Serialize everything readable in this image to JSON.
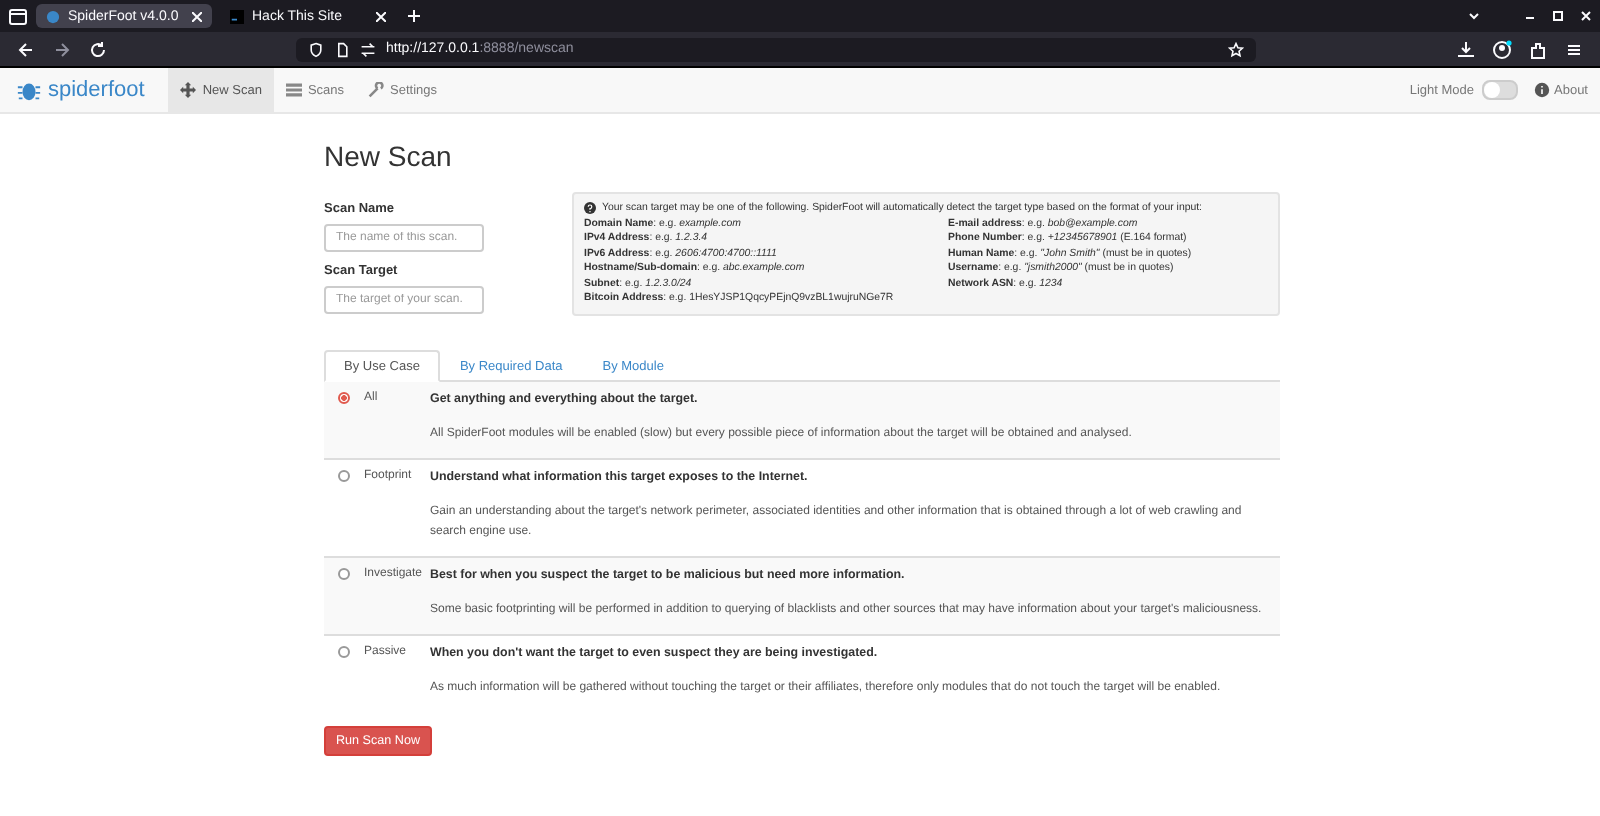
{
  "browser": {
    "tabs": [
      {
        "title": "SpiderFoot v4.0.0",
        "selected": true
      },
      {
        "title": "Hack This Site",
        "selected": false
      }
    ],
    "url_host": "http://127.0.0.1",
    "url_rest": ":8888/newscan"
  },
  "navbar": {
    "brand_a": "spider",
    "brand_b": "foot",
    "items": [
      {
        "label": "New Scan",
        "selected": true
      },
      {
        "label": "Scans",
        "selected": false
      },
      {
        "label": "Settings",
        "selected": false
      }
    ],
    "light_mode_label": "Light Mode",
    "light_mode_on": false,
    "about": "About"
  },
  "page_title": "New Scan",
  "fields": [
    {
      "label": "Scan Name",
      "placeholder": "The name of this scan."
    },
    {
      "label": "Scan Target",
      "placeholder": "The target of your scan."
    }
  ],
  "info": {
    "intro": "Your scan target may be one of the following. SpiderFoot will automatically detect the target type based on the format of your input:",
    "left": [
      "**Domain Name**: e.g. *example.com*",
      "**IPv4 Address**: e.g. *1.2.3.4*",
      "**IPv6 Address**: e.g. *2606:4700:4700::1111*",
      "**Hostname/Sub-domain**: e.g. *abc.example.com*",
      "**Subnet**: e.g. *1.2.3.0/24*",
      "**Bitcoin Address**: e.g. 1HesYJSP1QqcyPEjnQ9vzBL1wujruNGe7R"
    ],
    "right": [
      "**E-mail address**: e.g. *bob@example.com*",
      "**Phone Number**: e.g. *+12345678901* (E.164 format)",
      "**Human Name**: e.g. *\"John Smith\"* (must be in quotes)",
      "**Username**: e.g. *\"jsmith2000\"* (must be in quotes)",
      "**Network ASN**: e.g. *1234*"
    ]
  },
  "tabs": [
    {
      "label": "By Use Case",
      "selected": true
    },
    {
      "label": "By Required Data",
      "selected": false
    },
    {
      "label": "By Module",
      "selected": false
    }
  ],
  "use_cases": [
    {
      "name": "All",
      "selected": true,
      "heading": "Get anything and everything about the target.",
      "description": "All SpiderFoot modules will be enabled (slow) but every possible piece of information about the target will be obtained and analysed."
    },
    {
      "name": "Footprint",
      "selected": false,
      "heading": "Understand what information this target exposes to the Internet.",
      "description": "Gain an understanding about the target's network perimeter, associated identities and other information that is obtained through a lot of web crawling and search engine use."
    },
    {
      "name": "Investigate",
      "selected": false,
      "heading": "Best for when you suspect the target to be malicious but need more information.",
      "description": "Some basic footprinting will be performed in addition to querying of blacklists and other sources that may have information about your target's maliciousness."
    },
    {
      "name": "Passive",
      "selected": false,
      "heading": "When you don't want the target to even suspect they are being investigated.",
      "description": "As much information will be gathered without touching the target or their affiliates, therefore only modules that do not touch the target will be enabled."
    }
  ],
  "run_button": "Run Scan Now"
}
